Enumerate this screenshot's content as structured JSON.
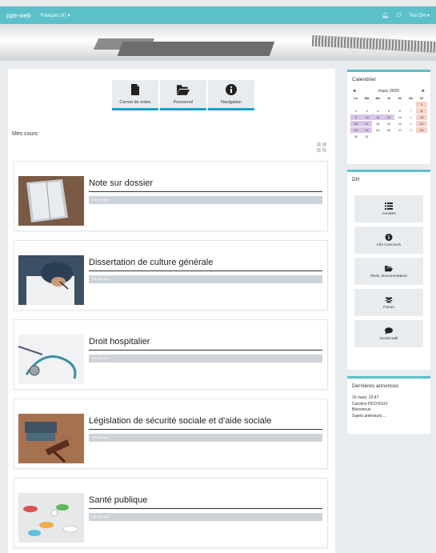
{
  "navbar": {
    "brand": "ppe-web",
    "language": "Français (fr) ▾",
    "user": "Test DH ▾",
    "icons": [
      "bell-icon",
      "chat-icon"
    ]
  },
  "quick_links": [
    {
      "label": "Carnet de notes",
      "icon": "file-icon"
    },
    {
      "label": "Personnel",
      "icon": "folder-open-icon"
    },
    {
      "label": "Navigation",
      "icon": "info-circle-icon"
    }
  ],
  "mes_cours": "Mes cours",
  "courses": [
    {
      "title": "Note sur dossier",
      "progress_label": "0% Terminé"
    },
    {
      "title": "Dissertation de culture générale",
      "progress_label": "0% Terminé"
    },
    {
      "title": "Droit hospitalier",
      "progress_label": "0% Terminé"
    },
    {
      "title": "Législation de sécurité sociale et d'aide sociale",
      "progress_label": "0% Terminé"
    },
    {
      "title": "Santé publique",
      "progress_label": "0% Terminé"
    }
  ],
  "calendar": {
    "title": "Calendrier",
    "month": "mars 2020",
    "prev": "◄",
    "next": "►",
    "weekdays": [
      "Lu",
      "Ma",
      "Me",
      "Je",
      "Ve",
      "Sa",
      "Di"
    ],
    "days": [
      "",
      "",
      "",
      "",
      "",
      "",
      "1",
      "2",
      "3",
      "4",
      "5",
      "6",
      "7",
      "8",
      "9",
      "10",
      "11",
      "12",
      "13",
      "14",
      "15",
      "16",
      "17",
      "18",
      "19",
      "20",
      "21",
      "22",
      "23",
      "24",
      "25",
      "26",
      "27",
      "28",
      "29",
      "30",
      "31",
      "",
      "",
      "",
      "",
      ""
    ]
  },
  "dh_block": {
    "title": "DH",
    "buttons": [
      {
        "label": "Annales",
        "icon": "list-icon"
      },
      {
        "label": "Info Concours",
        "icon": "info-circle-icon"
      },
      {
        "label": "Ress. Documentaires",
        "icon": "folder-open-icon"
      },
      {
        "label": "Forum",
        "icon": "users-icon"
      },
      {
        "label": "Social wall",
        "icon": "comment-icon"
      }
    ]
  },
  "announcements": {
    "title": "Dernières annonces",
    "date": "16 mars, 22:47",
    "author": "Caroline PÉCHOUX",
    "subject": "Bienvenue",
    "older": "Sujets antérieurs ..."
  },
  "colors": {
    "accent": "#5bc0c9",
    "quick_underline": "#17a2c9",
    "progress_bar": "#ced3d8",
    "calendar_weekend": "#f6d2c9",
    "calendar_event": "#d9c6e6"
  }
}
